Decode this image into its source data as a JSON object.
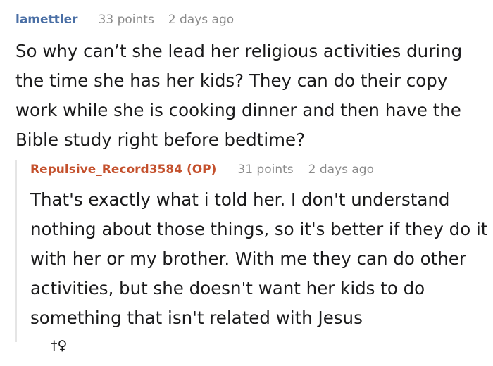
{
  "comment": {
    "author": "lamettler",
    "points": "33 points",
    "time": "2 days ago",
    "text": "So why can’t she lead her religious activities during the time she has her kids? They can do their copy work while she is cooking dinner and then have the Bible study right before bedtime?"
  },
  "reply": {
    "author": "Repulsive_Record3584 (OP)",
    "points": "31 points",
    "time": "2 days ago",
    "text": "That's exactly what i told her. I don't understand nothing about those things, so it's better if they do it with her or my brother. With me they can do other activities, but she doesn't want her kids to do something that isn't related with Jesus"
  },
  "footer": {
    "icon_name": "dagger-female-symbol-icon",
    "icon_glyph": "†♀"
  },
  "colors": {
    "author_blue": "#4a6fa5",
    "op_author_orange": "#c4502c",
    "meta_gray": "#8a8a8a",
    "text": "#1a1a1b"
  }
}
